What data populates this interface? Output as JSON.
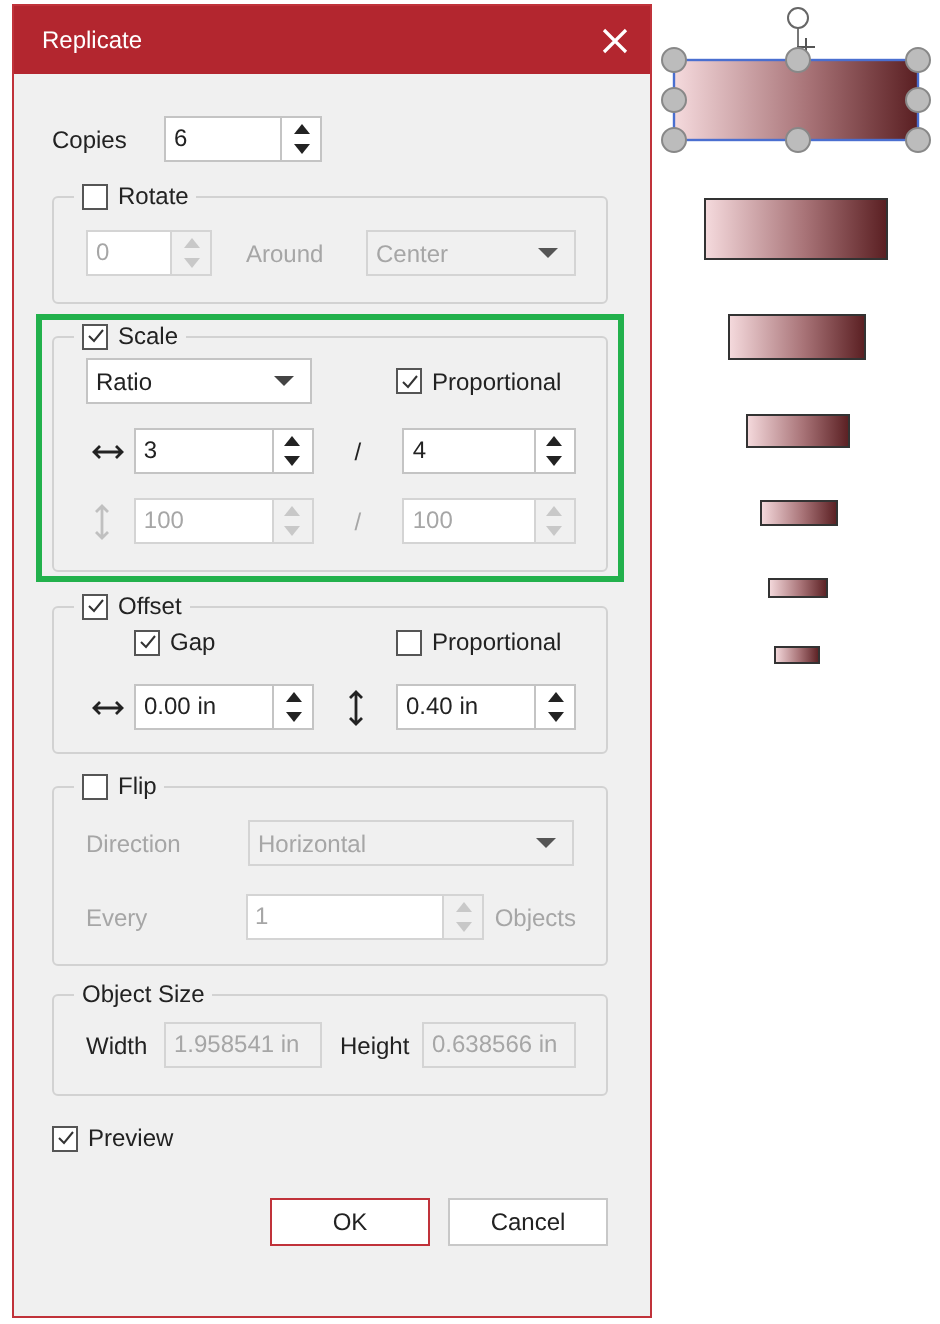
{
  "window": {
    "title": "Replicate"
  },
  "copies": {
    "label": "Copies",
    "value": "6"
  },
  "rotate": {
    "label": "Rotate",
    "checked": false,
    "angle": {
      "value": "0",
      "disabled": true
    },
    "around_label": "Around",
    "around": {
      "value": "Center",
      "disabled": true
    }
  },
  "scale": {
    "label": "Scale",
    "checked": true,
    "highlighted": true,
    "mode": {
      "value": "Ratio",
      "disabled": false
    },
    "proportional": {
      "label": "Proportional",
      "checked": true
    },
    "horizontal": {
      "disabled": false,
      "numerator": "3",
      "separator": "/",
      "denominator": "4"
    },
    "vertical": {
      "disabled": true,
      "numerator": "100",
      "separator": "/",
      "denominator": "100"
    }
  },
  "offset": {
    "label": "Offset",
    "checked": true,
    "gap": {
      "label": "Gap",
      "checked": true
    },
    "proportional": {
      "label": "Proportional",
      "checked": false
    },
    "horizontal": {
      "value": "0.00 in",
      "disabled": false
    },
    "vertical": {
      "value": "0.40 in",
      "disabled": false
    }
  },
  "flip": {
    "label": "Flip",
    "checked": false,
    "direction_label": "Direction",
    "direction": {
      "value": "Horizontal",
      "disabled": true
    },
    "every_label": "Every",
    "every": {
      "value": "1",
      "disabled": true
    },
    "objects_label": "Objects"
  },
  "object_size": {
    "label": "Object Size",
    "width_label": "Width",
    "width": {
      "value": "1.958541 in",
      "disabled": true
    },
    "height_label": "Height",
    "height": {
      "value": "0.638566 in",
      "disabled": true
    }
  },
  "preview": {
    "label": "Preview",
    "checked": true
  },
  "buttons": [
    {
      "label": "OK",
      "default": true
    },
    {
      "label": "Cancel",
      "default": false
    }
  ]
}
